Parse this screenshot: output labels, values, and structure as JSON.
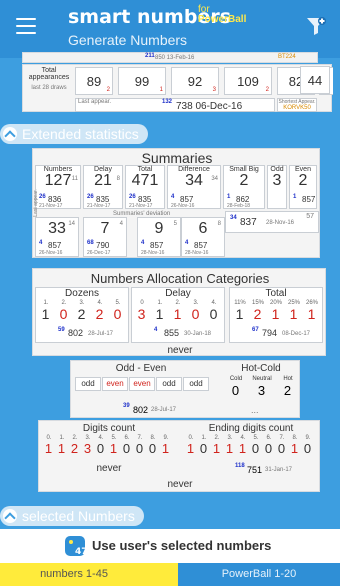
{
  "app": {
    "title": "smart numbers",
    "for": "for",
    "brand": "PowerBall",
    "subtitle": "Generate Numbers"
  },
  "top_strip": {
    "left_num": "211",
    "left_date": "850 13-Feb-16",
    "right": "BT224"
  },
  "total_appearances": {
    "label": "Total appearances",
    "sub": "last 28 draws",
    "values": [
      "89",
      "99",
      "92",
      "109",
      "82",
      "44"
    ],
    "small": [
      "2",
      "1",
      "3",
      "2",
      "1",
      ""
    ],
    "last_label": "Last appear.",
    "last_num": "132",
    "last_text": "738 06-Dec-16",
    "right_label": "Shortest Appear.",
    "right_text": "KORVK50"
  },
  "extended": {
    "title": "Extended statistics",
    "summaries_title": "Summaries",
    "cols": [
      {
        "label": "Numbers",
        "value": "127",
        "sup": "11",
        "blue": "26",
        "sub": "836",
        "date": "21-Nov-17"
      },
      {
        "label": "Delay",
        "value": "21",
        "sup": "8",
        "blue": "26",
        "sub": "835",
        "date": "21-Nov-17"
      },
      {
        "label": "Total",
        "value": "471",
        "sup": "",
        "blue": "26",
        "sub": "835",
        "date": "21-Nov-17"
      },
      {
        "label": "Difference",
        "value": "34",
        "sup": "34",
        "blue": "4",
        "sub": "857",
        "date": "26-Nov-16"
      },
      {
        "label": "Small Big",
        "value": "2",
        "sup": "",
        "blue": "1",
        "sub": "862",
        "date": "28-Feb-18"
      },
      {
        "label": "Odd",
        "value": "3",
        "sup": "",
        "blue": "",
        "sub": "",
        "date": ""
      },
      {
        "label": "Even",
        "value": "2",
        "sup": "",
        "blue": "1",
        "sub": "857",
        "date": ""
      }
    ],
    "row2": [
      {
        "value": "33",
        "sup": "14",
        "blue": "4",
        "sub": "857",
        "date": "26-Nov-16"
      },
      {
        "value": "7",
        "sup": "4",
        "blue": "68",
        "sub": "790",
        "date": "26-Dec-17"
      },
      {
        "value": "9",
        "sup": "5",
        "blue": "4",
        "sub": "857",
        "date": "28-Nov-16"
      },
      {
        "value": "6",
        "sup": "8",
        "blue": "4",
        "sub": "857",
        "date": "28-Nov-16"
      }
    ],
    "stdev_label": "Summaries' deviation",
    "right_blue": "34",
    "right_sub": "837",
    "right_date": "28-Nov-16",
    "right_small": "57",
    "last_label": "Last appear."
  },
  "allocation": {
    "title": "Numbers Allocation Categories",
    "groups": [
      {
        "name": "Dozens",
        "labels": [
          "1.",
          "2.",
          "3.",
          "4.",
          "5."
        ],
        "digits": [
          "1",
          "0",
          "2",
          "2",
          "0"
        ]
      },
      {
        "name": "Delay",
        "labels": [
          "0",
          "1.",
          "2.",
          "3.",
          "4."
        ],
        "digits": [
          "3",
          "1",
          "1",
          "0",
          "0"
        ]
      },
      {
        "name": "Total",
        "labels": [
          "11%",
          "15%",
          "20%",
          "25%",
          "26%"
        ],
        "digits": [
          "1",
          "2",
          "1",
          "1",
          "1"
        ]
      }
    ],
    "last": [
      {
        "blue": "59",
        "text": "802",
        "date": "28-Jul-17"
      },
      {
        "blue": "4",
        "text": "855",
        "date": "30-Jan-18"
      },
      {
        "blue": "67",
        "text": "794",
        "date": "08-Dec-17"
      }
    ],
    "never": "never"
  },
  "oddeven": {
    "title": "Odd - Even",
    "cells": [
      "odd",
      "even",
      "even",
      "odd",
      "odd"
    ],
    "hot_title": "Hot-Cold",
    "hot_cells": [
      "Cold",
      "Neutral",
      "Hot"
    ],
    "hot_vals": [
      "0",
      "3",
      "2"
    ],
    "blue": "39",
    "text": "802",
    "date": "28-Jul-17",
    "dots": "..."
  },
  "digits": {
    "title": "Digits count",
    "labels": [
      "0.",
      "1.",
      "2.",
      "3.",
      "4.",
      "5.",
      "6.",
      "7.",
      "8.",
      "9."
    ],
    "values": [
      "1",
      "1",
      "2",
      "3",
      "0",
      "1",
      "0",
      "0",
      "0",
      "1"
    ],
    "ending_title": "Ending digits count",
    "ending_values": [
      "1",
      "0",
      "1",
      "1",
      "1",
      "0",
      "0",
      "0",
      "1",
      "0"
    ],
    "never": "never",
    "blue": "118",
    "text": "751",
    "date": "31-Jan-17",
    "bottom_never": "never"
  },
  "selected": {
    "title": "selected Numbers",
    "button": "Use user's selected numbers",
    "tab1": "numbers 1-45",
    "tab2": "PowerBall 1-20"
  }
}
